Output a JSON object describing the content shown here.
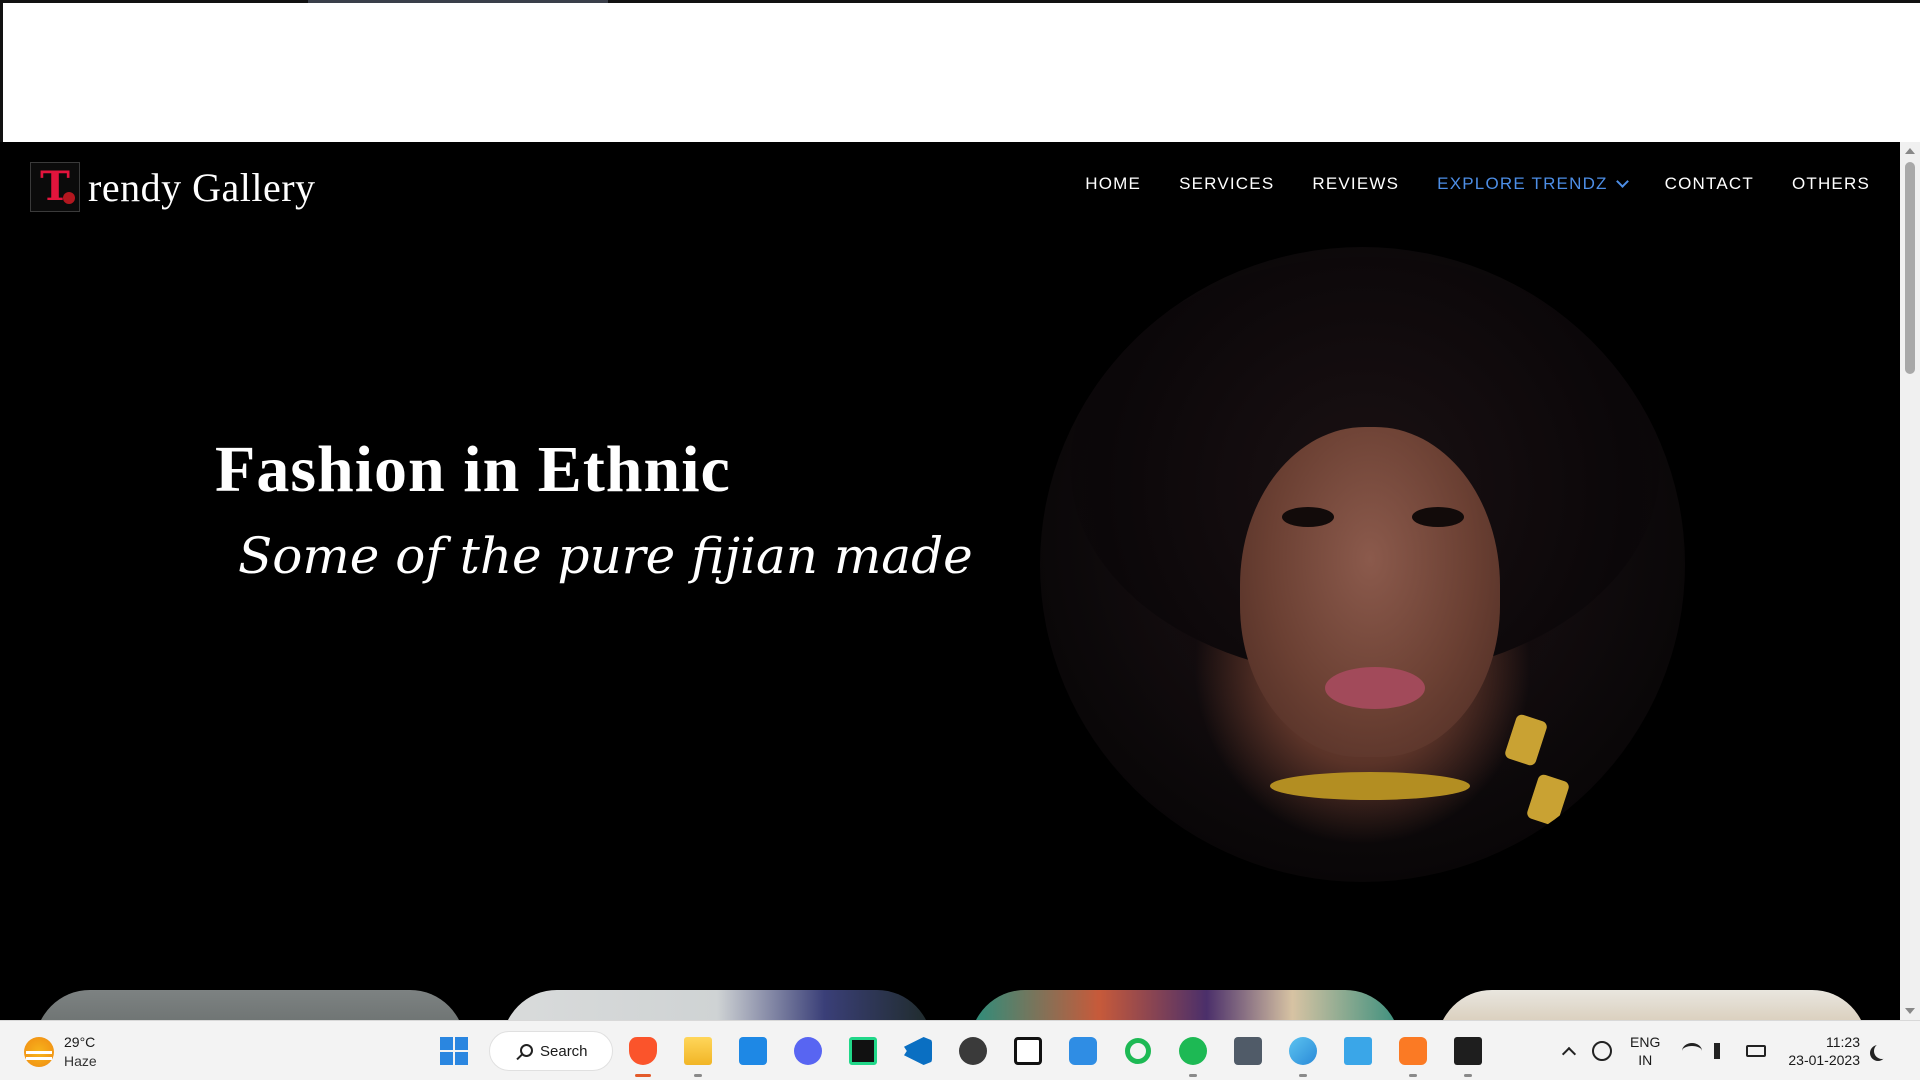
{
  "site": {
    "logo_letter": "T",
    "logo_text": "rendy Gallery",
    "nav": [
      {
        "label": "HOME"
      },
      {
        "label": "SERVICES"
      },
      {
        "label": "REVIEWS"
      },
      {
        "label": "EXPLORE TRENDZ"
      },
      {
        "label": "CONTACT"
      },
      {
        "label": "OTHERS"
      }
    ],
    "active_color": "#4d8ee6",
    "hero_title": "Fashion in Ethnic",
    "hero_subtitle": "Some of the pure fijian made"
  },
  "taskbar": {
    "weather_temp": "29°C",
    "weather_cond": "Haze",
    "search_label": "Search",
    "lang_top": "ENG",
    "lang_bottom": "IN",
    "time": "11:23",
    "date": "23-01-2023"
  }
}
